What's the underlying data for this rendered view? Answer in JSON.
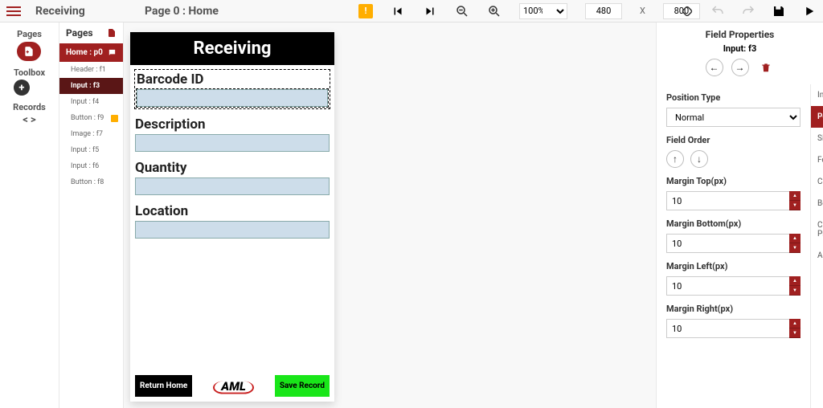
{
  "topbar": {
    "app_title": "Receiving",
    "page_title": "Page 0 : Home",
    "zoom": "100%",
    "width": "480",
    "height": "800",
    "x_label": "X"
  },
  "rail": {
    "pages": "Pages",
    "toolbox": "Toolbox",
    "records": "Records"
  },
  "pages_panel": {
    "title": "Pages",
    "root": "Home : p0",
    "items": [
      {
        "label": "Header : f1",
        "flag": false,
        "selected": false
      },
      {
        "label": "Input : f3",
        "flag": false,
        "selected": true
      },
      {
        "label": "Input : f4",
        "flag": false,
        "selected": false
      },
      {
        "label": "Button : f9",
        "flag": true,
        "selected": false
      },
      {
        "label": "Image : f7",
        "flag": false,
        "selected": false
      },
      {
        "label": "Input : f5",
        "flag": false,
        "selected": false
      },
      {
        "label": "Input : f6",
        "flag": false,
        "selected": false
      },
      {
        "label": "Button : f8",
        "flag": false,
        "selected": false
      }
    ]
  },
  "preview": {
    "header": "Receiving",
    "fields": [
      {
        "label": "Barcode ID",
        "selected": true
      },
      {
        "label": "Description",
        "selected": false
      },
      {
        "label": "Quantity",
        "selected": false
      },
      {
        "label": "Location",
        "selected": false
      }
    ],
    "btn_home": "Return Home",
    "btn_save": "Save Record",
    "logo_text": "AML"
  },
  "props": {
    "title": "Field Properties",
    "subtitle": "Input: f3",
    "position_type_label": "Position Type",
    "position_type_value": "Normal",
    "field_order_label": "Field Order",
    "margin_top_label": "Margin Top(px)",
    "margin_top_value": "10",
    "margin_bottom_label": "Margin Bottom(px)",
    "margin_bottom_value": "10",
    "margin_left_label": "Margin Left(px)",
    "margin_left_value": "10",
    "margin_right_label": "Margin Right(px)",
    "margin_right_value": "10",
    "tabs": [
      "Info",
      "Position",
      "Size",
      "Font",
      "Color",
      "Border",
      "Capture Properties",
      "Actions"
    ],
    "active_tab": "Position"
  }
}
